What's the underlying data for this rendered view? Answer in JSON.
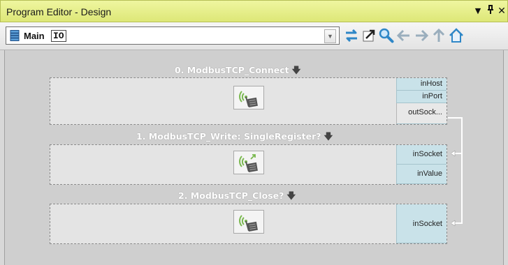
{
  "window": {
    "title": "Program Editor - Design",
    "controls": {
      "dropdown": "▼",
      "pin": "ᵽ",
      "close": "✕"
    }
  },
  "toolbar": {
    "program_name": "Main",
    "io_tag": "IO",
    "buttons": [
      "swap-icon",
      "open-external-icon",
      "search-icon",
      "back-arrow-icon",
      "forward-arrow-icon",
      "up-arrow-icon",
      "home-icon"
    ]
  },
  "blocks": [
    {
      "header": "0. ModbusTCP_Connect",
      "pins": [
        {
          "label": "inHost",
          "kind": "in"
        },
        {
          "label": "inPort",
          "kind": "in"
        },
        {
          "label": "outSock...",
          "kind": "out"
        }
      ]
    },
    {
      "header": "1. ModbusTCP_Write: SingleRegister?",
      "pins": [
        {
          "label": "inSocket",
          "kind": "in"
        },
        {
          "label": "inValue",
          "kind": "in"
        }
      ]
    },
    {
      "header": "2. ModbusTCP_Close?",
      "pins": [
        {
          "label": "inSocket",
          "kind": "in"
        }
      ]
    }
  ],
  "colors": {
    "title_bar": "#e6ee8a",
    "input_pin": "#c9e2e9",
    "accent_blue": "#2f87c7"
  }
}
